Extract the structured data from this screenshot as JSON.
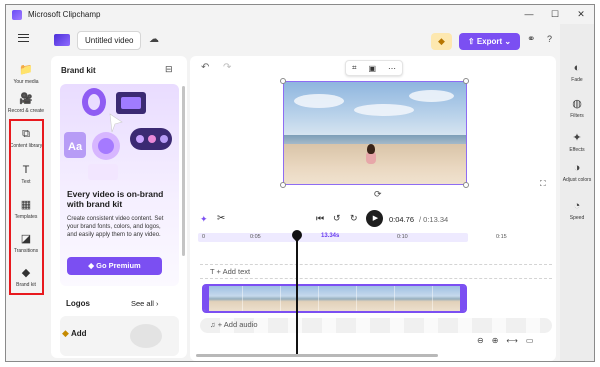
{
  "window": {
    "title": "Microsoft Clipchamp",
    "controls": [
      "—",
      "☐",
      "✕"
    ]
  },
  "toolbar": {
    "project_name": "Untitled video",
    "export_label": "Export",
    "export_chevron": "⌄",
    "premium_icon": "diamond-icon",
    "help_label": "?"
  },
  "sidebar": {
    "items": [
      {
        "label": "Your media",
        "icon": "📁"
      },
      {
        "label": "Record & create",
        "icon": "🎥"
      },
      {
        "label": "Content library",
        "icon": "⧉"
      },
      {
        "label": "Text",
        "icon": "T"
      },
      {
        "label": "Templates",
        "icon": "▦"
      },
      {
        "label": "Transitions",
        "icon": "◪"
      },
      {
        "label": "Brand kit",
        "icon": "◆"
      }
    ],
    "active": "Brand kit",
    "highlight_color": "#e8191e"
  },
  "panel": {
    "title": "Brand kit",
    "promo_heading": "Every video is on-brand with brand kit",
    "promo_body": "Create consistent video content. Set your brand fonts, colors, and logos, and easily apply them to any video.",
    "promo_button": "Go Premium",
    "logos_title": "Logos",
    "see_all": "See all",
    "add_label": "Add"
  },
  "player": {
    "current_time": "0:04.76",
    "total_time": "/ 0:13.34"
  },
  "timeline": {
    "ruler_labels": [
      "0",
      "0:05",
      "13.34s",
      "0:10",
      "0:15"
    ],
    "add_text": "+ Add text",
    "add_audio": "+ Add audio"
  },
  "rightbar": {
    "items": [
      {
        "label": "Fade",
        "icon": "◐"
      },
      {
        "label": "Filters",
        "icon": "◍"
      },
      {
        "label": "Effects",
        "icon": "✦"
      },
      {
        "label": "Adjust colors",
        "icon": "◑"
      },
      {
        "label": "Speed",
        "icon": "◔"
      }
    ]
  },
  "colors": {
    "accent": "#7b4ff2",
    "premium": "#fde8b0"
  }
}
